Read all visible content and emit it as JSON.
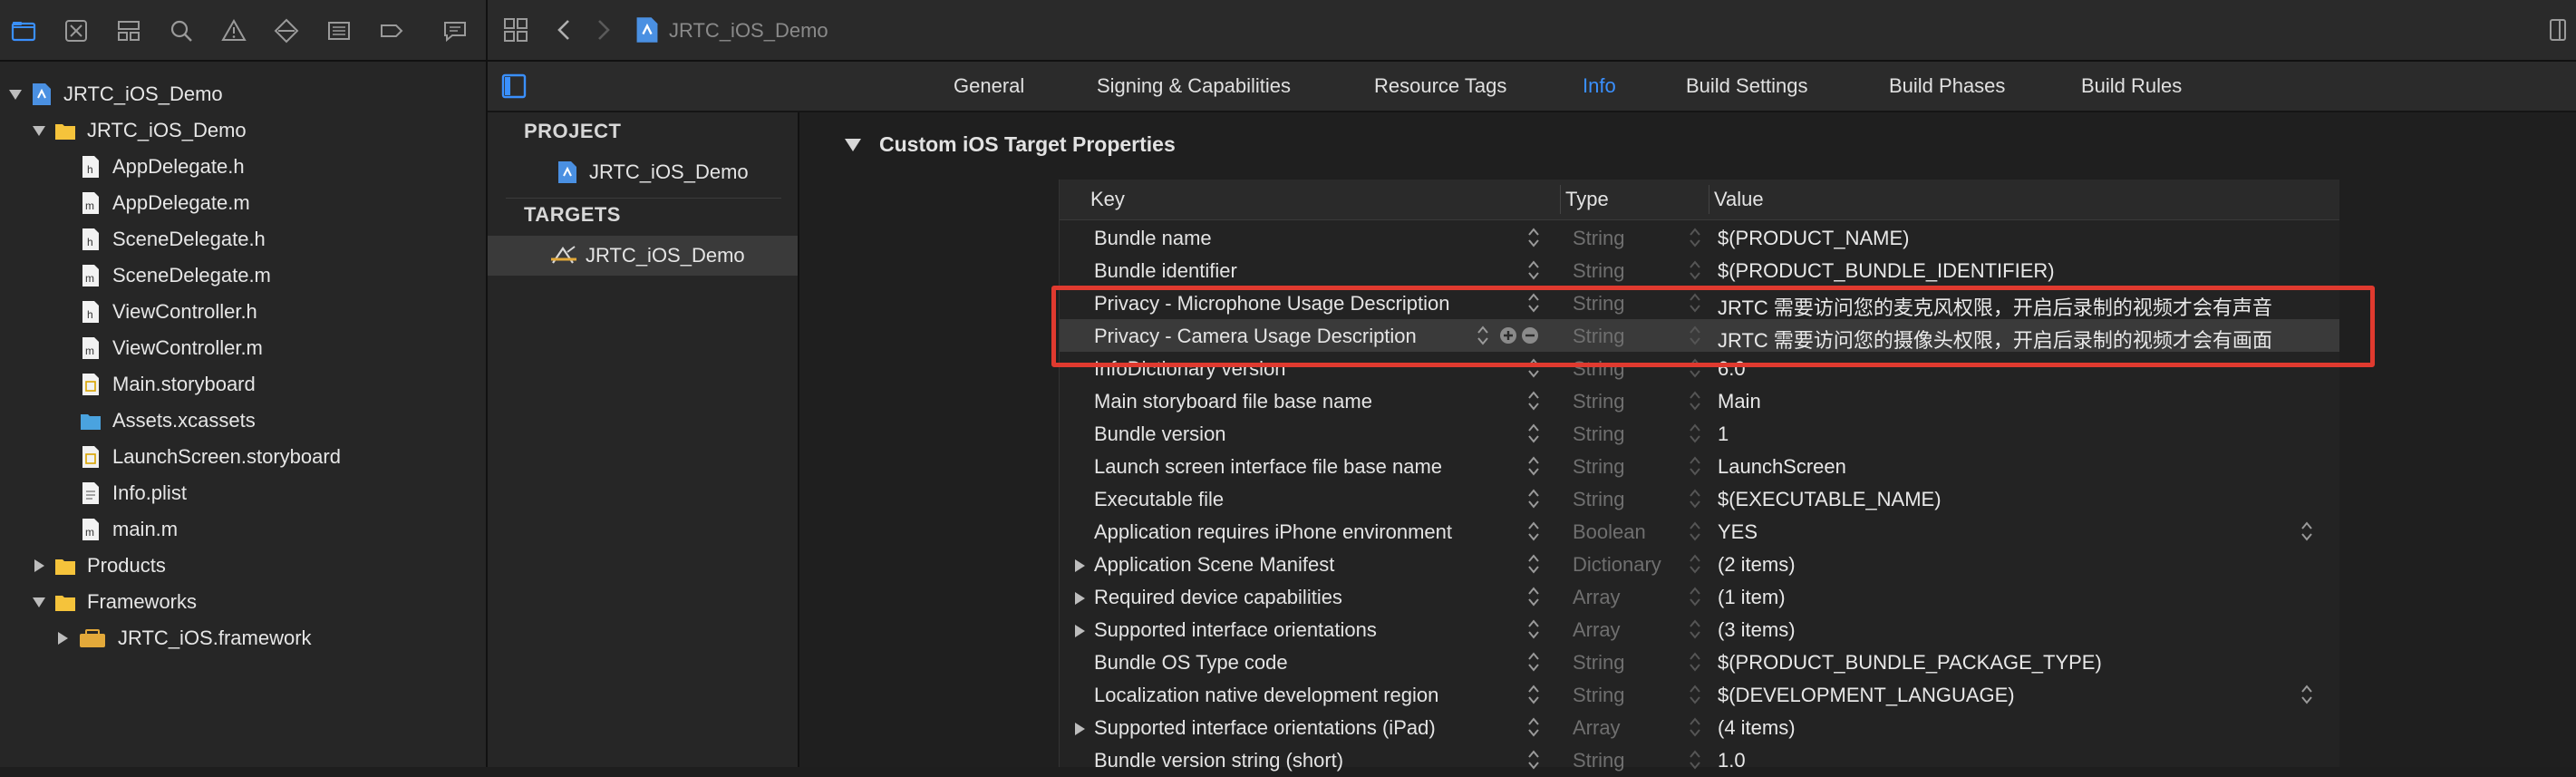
{
  "navigator": {
    "toolbar_icons": [
      "folder-icon",
      "source-control-icon",
      "symbol-icon",
      "find-icon",
      "issue-icon",
      "test-icon",
      "debug-icon",
      "breakpoint-icon",
      "report-icon"
    ],
    "tree": [
      {
        "label": "JRTC_iOS_Demo",
        "icon": "project-icon",
        "level": 0,
        "disclosure": "open"
      },
      {
        "label": "JRTC_iOS_Demo",
        "icon": "folder-icon",
        "level": 1,
        "disclosure": "open"
      },
      {
        "label": "AppDelegate.h",
        "icon": "header-file-icon",
        "level": 2
      },
      {
        "label": "AppDelegate.m",
        "icon": "source-file-icon",
        "level": 2
      },
      {
        "label": "SceneDelegate.h",
        "icon": "header-file-icon",
        "level": 2
      },
      {
        "label": "SceneDelegate.m",
        "icon": "source-file-icon",
        "level": 2
      },
      {
        "label": "ViewController.h",
        "icon": "header-file-icon",
        "level": 2
      },
      {
        "label": "ViewController.m",
        "icon": "source-file-icon",
        "level": 2
      },
      {
        "label": "Main.storyboard",
        "icon": "storyboard-icon",
        "level": 2
      },
      {
        "label": "Assets.xcassets",
        "icon": "assets-icon",
        "level": 2
      },
      {
        "label": "LaunchScreen.storyboard",
        "icon": "storyboard-icon",
        "level": 2
      },
      {
        "label": "Info.plist",
        "icon": "plist-icon",
        "level": 2
      },
      {
        "label": "main.m",
        "icon": "source-file-icon",
        "level": 2
      },
      {
        "label": "Products",
        "icon": "folder-icon",
        "level": 1,
        "disclosure": "closed"
      },
      {
        "label": "Frameworks",
        "icon": "folder-icon",
        "level": 1,
        "disclosure": "open"
      },
      {
        "label": "JRTC_iOS.framework",
        "icon": "framework-icon",
        "level": 2,
        "disclosure": "closed"
      }
    ]
  },
  "editor": {
    "breadcrumb": "JRTC_iOS_Demo"
  },
  "tabs": [
    {
      "label": "General",
      "active": false
    },
    {
      "label": "Signing & Capabilities",
      "active": false
    },
    {
      "label": "Resource Tags",
      "active": false
    },
    {
      "label": "Info",
      "active": true
    },
    {
      "label": "Build Settings",
      "active": false
    },
    {
      "label": "Build Phases",
      "active": false
    },
    {
      "label": "Build Rules",
      "active": false
    }
  ],
  "targets_pane": {
    "project_title": "PROJECT",
    "project_item": "JRTC_iOS_Demo",
    "targets_title": "TARGETS",
    "target_item": "JRTC_iOS_Demo"
  },
  "info": {
    "section_title": "Custom iOS Target Properties",
    "columns": {
      "key": "Key",
      "type": "Type",
      "value": "Value"
    },
    "rows": [
      {
        "key": "Bundle name",
        "type": "String",
        "value": "$(PRODUCT_NAME)"
      },
      {
        "key": "Bundle identifier",
        "type": "String",
        "value": "$(PRODUCT_BUNDLE_IDENTIFIER)"
      },
      {
        "key": "Privacy - Microphone Usage Description",
        "type": "String",
        "value": "JRTC 需要访问您的麦克风权限，开启后录制的视频才会有声音",
        "highlighted": true
      },
      {
        "key": "Privacy - Camera Usage Description",
        "type": "String",
        "value": "JRTC 需要访问您的摄像头权限，开启后录制的视频才会有画面",
        "highlighted": true,
        "selected": true
      },
      {
        "key": "InfoDictionary version",
        "type": "String",
        "value": "6.0"
      },
      {
        "key": "Main storyboard file base name",
        "type": "String",
        "value": "Main"
      },
      {
        "key": "Bundle version",
        "type": "String",
        "value": "1"
      },
      {
        "key": "Launch screen interface file base name",
        "type": "String",
        "value": "LaunchScreen"
      },
      {
        "key": "Executable file",
        "type": "String",
        "value": "$(EXECUTABLE_NAME)"
      },
      {
        "key": "Application requires iPhone environment",
        "type": "Boolean",
        "value": "YES",
        "value_stepper": true
      },
      {
        "key": "Application Scene Manifest",
        "type": "Dictionary",
        "value": "(2 items)",
        "expandable": true
      },
      {
        "key": "Required device capabilities",
        "type": "Array",
        "value": "(1 item)",
        "expandable": true
      },
      {
        "key": "Supported interface orientations",
        "type": "Array",
        "value": "(3 items)",
        "expandable": true
      },
      {
        "key": "Bundle OS Type code",
        "type": "String",
        "value": "$(PRODUCT_BUNDLE_PACKAGE_TYPE)"
      },
      {
        "key": "Localization native development region",
        "type": "String",
        "value": "$(DEVELOPMENT_LANGUAGE)",
        "value_stepper": true
      },
      {
        "key": "Supported interface orientations (iPad)",
        "type": "Array",
        "value": "(4 items)",
        "expandable": true
      },
      {
        "key": "Bundle version string (short)",
        "type": "String",
        "value": "1.0"
      }
    ]
  },
  "colors": {
    "accent": "#3a90ff",
    "highlight_box": "#e03a2f",
    "folder": "#f5c33b"
  }
}
